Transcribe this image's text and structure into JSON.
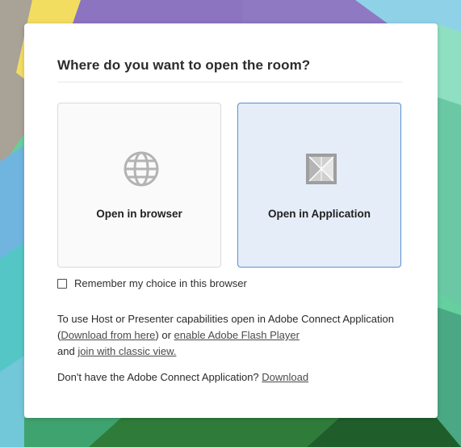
{
  "dialog": {
    "title": "Where do you want to open the room?",
    "options": [
      {
        "label": "Open in browser",
        "icon": "globe-icon",
        "selected": false
      },
      {
        "label": "Open in Application",
        "icon": "adobe-connect-app-icon",
        "selected": true
      }
    ],
    "remember": {
      "label": "Remember my choice in this browser",
      "checked": false
    },
    "info": {
      "text1": "To use Host or Presenter capabilities open in Adobe Connect Application (",
      "download_link": "Download from here",
      "text2": ") or ",
      "flash_link": "enable Adobe Flash Player",
      "text3": "and ",
      "classic_link": "join with classic view."
    },
    "footer": {
      "text": "Don't have the Adobe Connect Application? ",
      "download_link": "Download"
    }
  },
  "colors": {
    "selected_bg": "#e5edf8",
    "selected_border": "#5b8fd0",
    "background_accent": "#5cc9a0"
  }
}
